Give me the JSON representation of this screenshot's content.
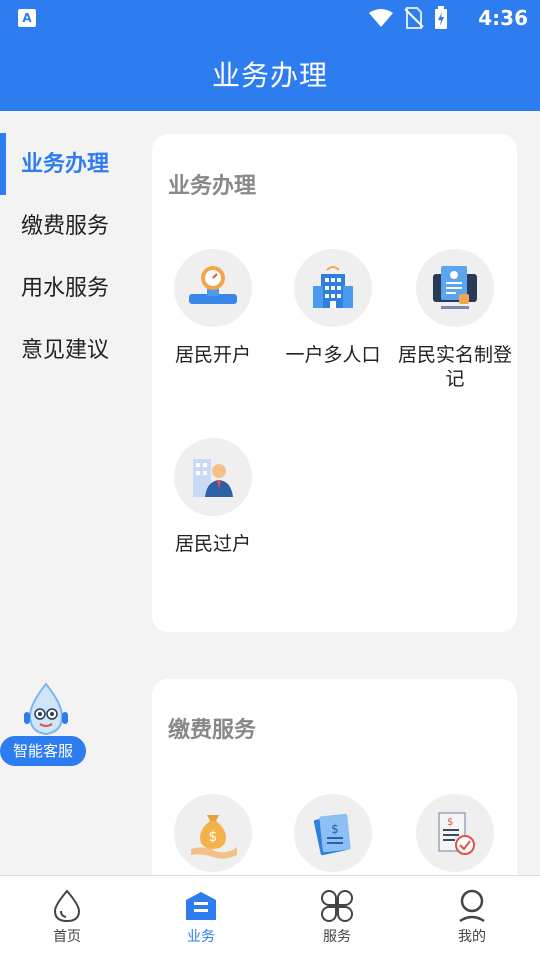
{
  "status_bar": {
    "time": "4:36",
    "app_badge": "A"
  },
  "header": {
    "title": "业务办理"
  },
  "sidebar": {
    "items": [
      {
        "label": "业务办理",
        "active": true
      },
      {
        "label": "缴费服务",
        "active": false
      },
      {
        "label": "用水服务",
        "active": false
      },
      {
        "label": "意见建议",
        "active": false
      }
    ]
  },
  "sections": [
    {
      "title": "业务办理",
      "tiles": [
        {
          "label": "居民开户",
          "icon": "water-meter-icon"
        },
        {
          "label": "一户多人口",
          "icon": "building-icon"
        },
        {
          "label": "居民实名制登记",
          "icon": "id-registration-icon"
        },
        {
          "label": "居民过户",
          "icon": "transfer-person-icon"
        }
      ]
    },
    {
      "title": "缴费服务",
      "tiles": [
        {
          "icon": "money-bag-icon"
        },
        {
          "icon": "bill-icon"
        },
        {
          "icon": "invoice-check-icon"
        }
      ]
    }
  ],
  "assistant": {
    "label": "智能客服",
    "icon": "water-drop-mascot-icon"
  },
  "bottom_nav": [
    {
      "label": "首页",
      "icon": "water-drop-icon",
      "active": false
    },
    {
      "label": "业务",
      "icon": "business-icon",
      "active": true
    },
    {
      "label": "服务",
      "icon": "services-grid-icon",
      "active": false
    },
    {
      "label": "我的",
      "icon": "profile-icon",
      "active": false
    }
  ],
  "colors": {
    "primary": "#2d7cf0",
    "background": "#f3f3f3",
    "card": "#ffffff",
    "muted": "#888888"
  }
}
